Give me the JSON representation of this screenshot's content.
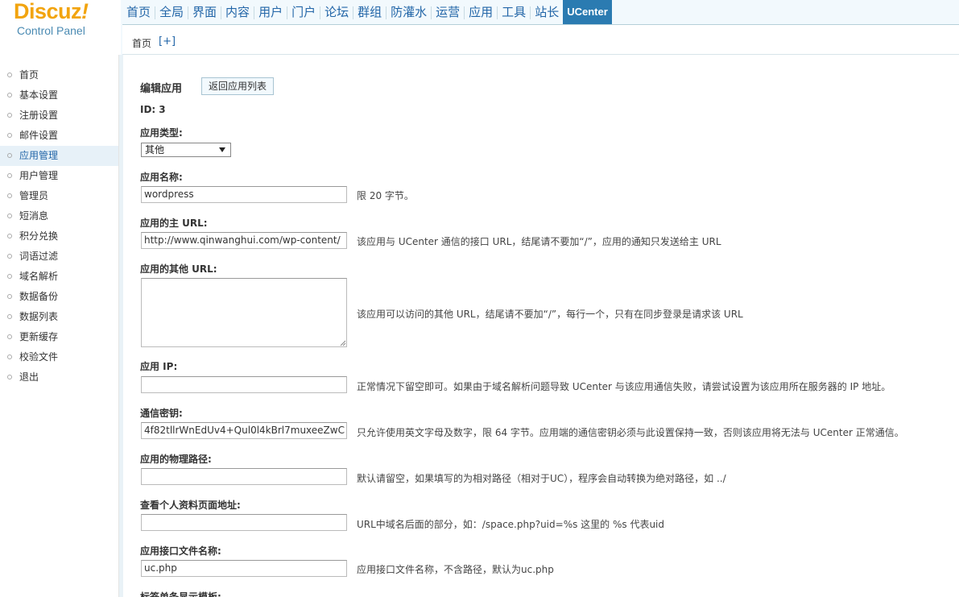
{
  "logo": {
    "brand": "Discuz",
    "bang": "!",
    "subtitle": "Control Panel"
  },
  "topnav": [
    "首页",
    "全局",
    "界面",
    "内容",
    "用户",
    "门户",
    "论坛",
    "群组",
    "防灌水",
    "运营",
    "应用",
    "工具",
    "站长",
    "UCenter"
  ],
  "topnav_active": "UCenter",
  "breadcrumb": {
    "home": "首页",
    "add": "[+]"
  },
  "sidebar": {
    "items": [
      "首页",
      "基本设置",
      "注册设置",
      "邮件设置",
      "应用管理",
      "用户管理",
      "管理员",
      "短消息",
      "积分兑换",
      "词语过滤",
      "域名解析",
      "数据备份",
      "数据列表",
      "更新缓存",
      "校验文件",
      "退出"
    ],
    "active": "应用管理"
  },
  "form": {
    "title": "编辑应用",
    "back_button": "返回应用列表",
    "id_label": "ID:",
    "id_value": "3",
    "type_label": "应用类型:",
    "type_value": "其他",
    "name_label": "应用名称:",
    "name_value": "wordpress",
    "name_help": "限 20 字节。",
    "url_label": "应用的主 URL:",
    "url_value": "http://www.qinwanghui.com/wp-content/",
    "url_help": "该应用与 UCenter 通信的接口 URL，结尾请不要加“/”，应用的通知只发送给主 URL",
    "other_url_label": "应用的其他 URL:",
    "other_url_value": "",
    "other_url_help": "该应用可以访问的其他 URL，结尾请不要加“/”，每行一个，只有在同步登录是请求该 URL",
    "ip_label": "应用 IP:",
    "ip_value": "",
    "ip_help": "正常情况下留空即可。如果由于域名解析问题导致 UCenter 与该应用通信失败，请尝试设置为该应用所在服务器的 IP 地址。",
    "key_label": "通信密钥:",
    "key_value": "4f82tllrWnEdUv4+Qul0l4kBrl7muxeeZwC",
    "key_help": "只允许使用英文字母及数字，限 64 字节。应用端的通信密钥必须与此设置保持一致，否则该应用将无法与 UCenter 正常通信。",
    "path_label": "应用的物理路径:",
    "path_value": "",
    "path_help": "默认请留空，如果填写的为相对路径（相对于UC），程序会自动转换为绝对路径，如 ../",
    "profile_label": "查看个人资料页面地址:",
    "profile_value": "",
    "profile_help": "URL中域名后面的部分，如：/space.php?uid=%s 这里的 %s 代表uid",
    "api_label": "应用接口文件名称:",
    "api_value": "uc.php",
    "api_help": "应用接口文件名称，不含路径，默认为uc.php",
    "tag_label": "标签单条显示模板:"
  },
  "colors": {
    "brand": "#f2a40f",
    "nav_text": "#2366a8",
    "nav_active_bg": "#2b7bb1",
    "header_bg": "#f2f9fd"
  }
}
